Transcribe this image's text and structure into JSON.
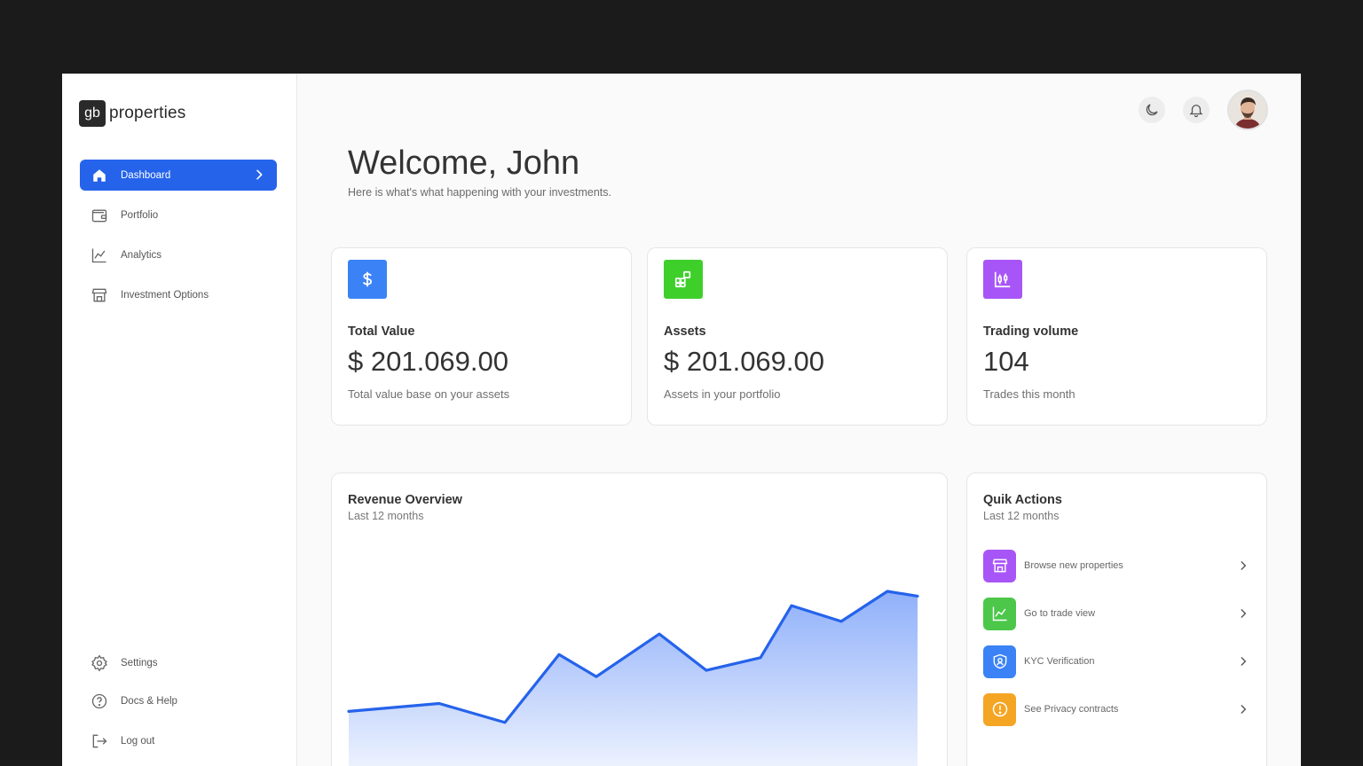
{
  "brand": {
    "mark": "gb",
    "name": "properties"
  },
  "sidebar": {
    "items": [
      {
        "label": "Dashboard",
        "icon": "home-icon",
        "active": true
      },
      {
        "label": "Portfolio",
        "icon": "wallet-icon"
      },
      {
        "label": "Analytics",
        "icon": "chart-icon"
      },
      {
        "label": "Investment Options",
        "icon": "store-icon"
      }
    ],
    "bottom_items": [
      {
        "label": "Settings",
        "icon": "gear-icon"
      },
      {
        "label": "Docs & Help",
        "icon": "help-icon"
      },
      {
        "label": "Log out",
        "icon": "logout-icon"
      }
    ]
  },
  "header": {
    "theme_icon": "moon-icon",
    "notification_icon": "bell-icon"
  },
  "welcome": {
    "title": "Welcome, John",
    "subtitle": "Here is what's what happening with your investments."
  },
  "stats": [
    {
      "title": "Total Value",
      "value": "$ 201.069.00",
      "subtitle": "Total value base on your assets",
      "icon": "dollar-icon",
      "color": "#3b82f6"
    },
    {
      "title": "Assets",
      "value": "$ 201.069.00",
      "subtitle": "Assets in your portfolio",
      "icon": "grid-icon",
      "color": "#22c55e"
    },
    {
      "title": "Trading volume",
      "value": "104",
      "subtitle": "Trades this month",
      "icon": "candles-icon",
      "color": "#a855f7"
    }
  ],
  "revenue": {
    "title": "Revenue Overview",
    "subtitle": "Last 12 months",
    "line_color": "#2563eb"
  },
  "chart_data": {
    "type": "area",
    "title": "Revenue Overview",
    "subtitle": "Last 12 months",
    "values": [
      43,
      48,
      36,
      79,
      65,
      92,
      69,
      77,
      110,
      100,
      119,
      116
    ],
    "ylim": [
      0,
      160
    ],
    "grid": false,
    "legend": "none"
  },
  "quick_actions": {
    "title": "Quik Actions",
    "subtitle": "Last 12 months",
    "items": [
      {
        "label": "Browse new properties",
        "icon": "store-icon",
        "color": "#a855f7"
      },
      {
        "label": "Go to trade view",
        "icon": "chart-icon",
        "color": "#22c55e"
      },
      {
        "label": "KYC Verification",
        "icon": "shield-user-icon",
        "color": "#3b82f6"
      },
      {
        "label": "See Privacy contracts",
        "icon": "alert-icon",
        "color": "#f5a524"
      }
    ]
  }
}
